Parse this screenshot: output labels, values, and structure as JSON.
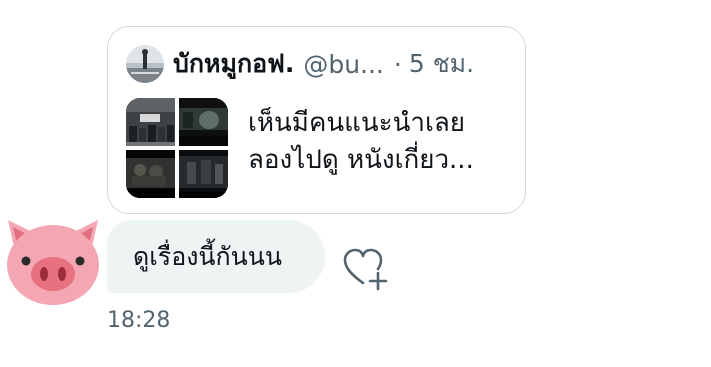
{
  "quoted_tweet": {
    "author_name": "บักหมูกอฟ.",
    "handle": "@bu...",
    "separator": "·",
    "time_ago": "5 ชม.",
    "text_lines": [
      "เห็นมีคนแนะนำเลย",
      "ลองไปดู หนังเกี่ยว..."
    ],
    "media_count": 4
  },
  "message": {
    "text": "ดูเรื่องนี้กันนน",
    "timestamp": "18:28",
    "sender_avatar": "pig-face-emoji",
    "reaction_icon": "add-reaction-heart-icon"
  },
  "colors": {
    "bubble_bg": "#eef3f4",
    "card_border": "#cfd9de",
    "secondary_text": "#536471",
    "pig_pink": "#f4a7b2"
  }
}
